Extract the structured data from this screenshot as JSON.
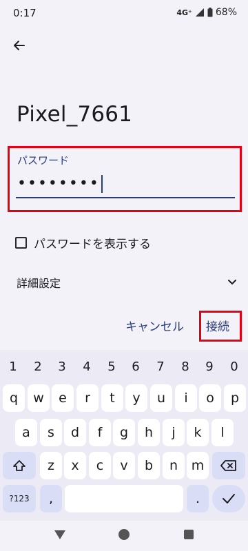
{
  "status_bar": {
    "time": "0:17",
    "network": "4G⁺",
    "battery": "68%"
  },
  "header": {
    "title": "Pixel_7661"
  },
  "password_field": {
    "label": "パスワード",
    "value": "••••••••"
  },
  "show_password": {
    "label": "パスワードを表示する"
  },
  "advanced": {
    "label": "詳細設定"
  },
  "actions": {
    "cancel": "キャンセル",
    "connect": "接続"
  },
  "keyboard": {
    "numbers": [
      "1",
      "2",
      "3",
      "4",
      "5",
      "6",
      "7",
      "8",
      "9",
      "0"
    ],
    "row1": [
      "q",
      "w",
      "e",
      "r",
      "t",
      "y",
      "u",
      "i",
      "o",
      "p"
    ],
    "row2": [
      "a",
      "s",
      "d",
      "f",
      "g",
      "h",
      "j",
      "k",
      "l"
    ],
    "row3": [
      "z",
      "x",
      "c",
      "v",
      "b",
      "n",
      "m"
    ],
    "symbols_label": "?123",
    "comma": ",",
    "period": "."
  },
  "highlight_color": "#e60012",
  "accent_color": "#2b3e7a"
}
